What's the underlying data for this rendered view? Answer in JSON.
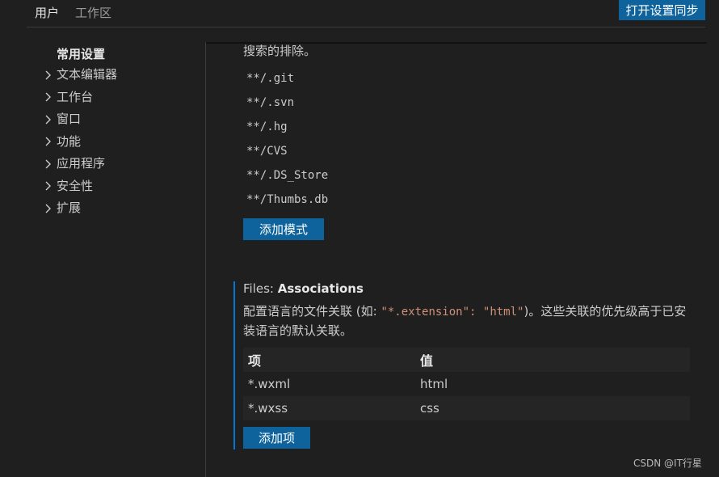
{
  "header": {
    "tabs": [
      {
        "label": "用户",
        "active": true
      },
      {
        "label": "工作区",
        "active": false
      }
    ],
    "sync_button": "打开设置同步"
  },
  "toc": {
    "title": "常用设置",
    "items": [
      {
        "label": "文本编辑器",
        "icon": "chevron-right-icon"
      },
      {
        "label": "工作台",
        "icon": "chevron-right-icon"
      },
      {
        "label": "窗口",
        "icon": "chevron-right-icon"
      },
      {
        "label": "功能",
        "icon": "chevron-right-icon"
      },
      {
        "label": "应用程序",
        "icon": "chevron-right-icon"
      },
      {
        "label": "安全性",
        "icon": "chevron-right-icon"
      },
      {
        "label": "扩展",
        "icon": "chevron-right-icon"
      }
    ]
  },
  "exclude": {
    "desc_tail": "搜索的排除。",
    "patterns": [
      "**/.git",
      "**/.svn",
      "**/.hg",
      "**/CVS",
      "**/.DS_Store",
      "**/Thumbs.db"
    ],
    "add_button": "添加模式"
  },
  "associations": {
    "category": "Files: ",
    "key": "Associations",
    "desc_prefix": "配置语言的文件关联 (如: ",
    "code_a": "\"*.extension\": \"html\"",
    "desc_suffix": ")。这些关联的优先级高于已安装语言的默认关联。",
    "table": {
      "header": {
        "item": "项",
        "value": "值"
      },
      "rows": [
        {
          "item": "*.wxml",
          "value": "html"
        },
        {
          "item": "*.wxss",
          "value": "css"
        }
      ]
    },
    "add_button": "添加项"
  },
  "watermark": "CSDN @IT行星",
  "colors": {
    "background": "#1f1f1f",
    "accent": "#0e639c",
    "focus": "#0078d4",
    "code_string": "#ce9178"
  }
}
